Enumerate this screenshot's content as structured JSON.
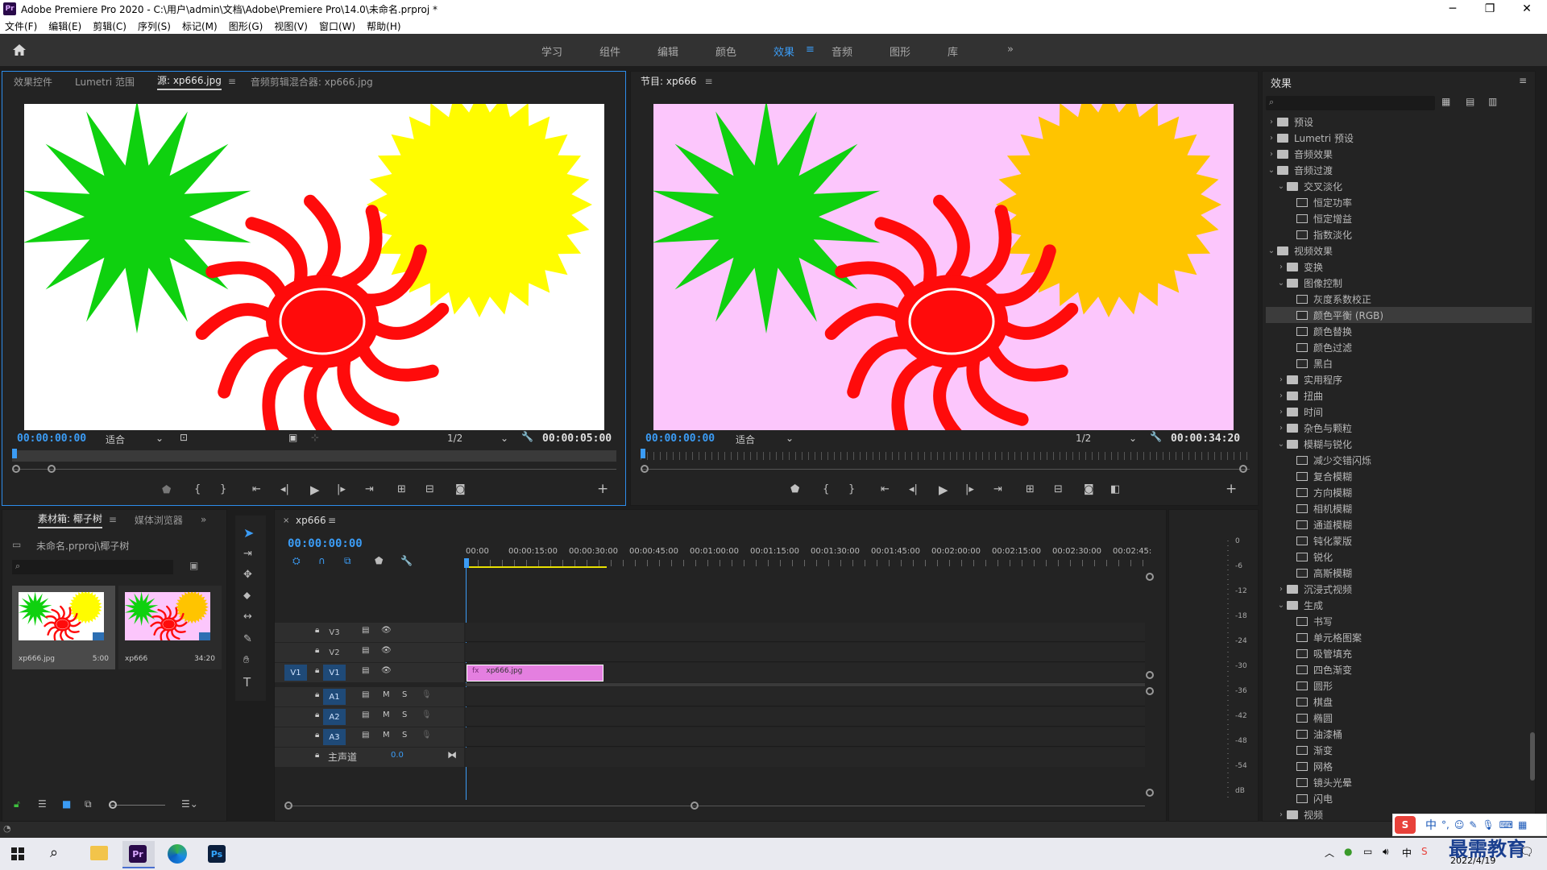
{
  "window": {
    "app_icon": "Pr",
    "title": "Adobe Premiere Pro 2020 - C:\\用户\\admin\\文档\\Adobe\\Premiere Pro\\14.0\\未命名.prproj *"
  },
  "menu": [
    "文件(F)",
    "编辑(E)",
    "剪辑(C)",
    "序列(S)",
    "标记(M)",
    "图形(G)",
    "视图(V)",
    "窗口(W)",
    "帮助(H)"
  ],
  "workspaces": {
    "tabs": [
      "学习",
      "组件",
      "编辑",
      "颜色",
      "效果",
      "音频",
      "图形",
      "库"
    ],
    "active": "效果"
  },
  "source_panel": {
    "tabs": [
      "效果控件",
      "Lumetri 范围",
      "源: xp666.jpg",
      "音频剪辑混合器: xp666.jpg"
    ],
    "timecode": "00:00:00:00",
    "fit": "适合",
    "resolution": "1/2",
    "duration": "00:00:05:00",
    "background": "#ffffff"
  },
  "program_panel": {
    "tab": "节目: xp666",
    "timecode": "00:00:00:00",
    "fit": "适合",
    "resolution": "1/2",
    "duration": "00:00:34:20",
    "background": "#fcc6fc"
  },
  "project_panel": {
    "tabs": [
      "素材箱: 椰子树",
      "媒体浏览器"
    ],
    "path": "未命名.prproj\\椰子树",
    "items": [
      {
        "name": "xp666.jpg",
        "duration": "5:00"
      },
      {
        "name": "xp666",
        "duration": "34:20"
      }
    ]
  },
  "timeline": {
    "tab": "xp666",
    "timecode": "00:00:00:00",
    "ruler": [
      "00:00",
      "00:00:15:00",
      "00:00:30:00",
      "00:00:45:00",
      "00:01:00:00",
      "00:01:15:00",
      "00:01:30:00",
      "00:01:45:00",
      "00:02:00:00",
      "00:02:15:00",
      "00:02:30:00",
      "00:02:45:"
    ],
    "video_tracks": [
      "V3",
      "V2",
      "V1"
    ],
    "audio_tracks": [
      "A1",
      "A2",
      "A3"
    ],
    "source_patch": "V1",
    "master": {
      "label": "主声道",
      "value": "0.0"
    },
    "clip": {
      "name": "xp666.jpg",
      "color": "#e47fe0"
    },
    "meter_labels": [
      "0",
      "-6",
      "-12",
      "-18",
      "-24",
      "-30",
      "-36",
      "-42",
      "-48",
      "-54",
      "dB"
    ]
  },
  "effects_panel": {
    "title": "效果",
    "search_placeholder": "",
    "tree": [
      {
        "label": "预设",
        "level": 0,
        "type": "folder",
        "open": false
      },
      {
        "label": "Lumetri 预设",
        "level": 0,
        "type": "folder",
        "open": false
      },
      {
        "label": "音频效果",
        "level": 0,
        "type": "folder",
        "open": false
      },
      {
        "label": "音频过渡",
        "level": 0,
        "type": "folder",
        "open": true
      },
      {
        "label": "交叉淡化",
        "level": 1,
        "type": "folder",
        "open": true
      },
      {
        "label": "恒定功率",
        "level": 2,
        "type": "fx"
      },
      {
        "label": "恒定增益",
        "level": 2,
        "type": "fx"
      },
      {
        "label": "指数淡化",
        "level": 2,
        "type": "fx"
      },
      {
        "label": "视频效果",
        "level": 0,
        "type": "folder",
        "open": true
      },
      {
        "label": "变换",
        "level": 1,
        "type": "folder",
        "open": false
      },
      {
        "label": "图像控制",
        "level": 1,
        "type": "folder",
        "open": true
      },
      {
        "label": "灰度系数校正",
        "level": 2,
        "type": "fx"
      },
      {
        "label": "颜色平衡 (RGB)",
        "level": 2,
        "type": "fx",
        "selected": true
      },
      {
        "label": "颜色替换",
        "level": 2,
        "type": "fx"
      },
      {
        "label": "颜色过滤",
        "level": 2,
        "type": "fx"
      },
      {
        "label": "黑白",
        "level": 2,
        "type": "fx"
      },
      {
        "label": "实用程序",
        "level": 1,
        "type": "folder",
        "open": false
      },
      {
        "label": "扭曲",
        "level": 1,
        "type": "folder",
        "open": false
      },
      {
        "label": "时间",
        "level": 1,
        "type": "folder",
        "open": false
      },
      {
        "label": "杂色与颗粒",
        "level": 1,
        "type": "folder",
        "open": false
      },
      {
        "label": "模糊与锐化",
        "level": 1,
        "type": "folder",
        "open": true
      },
      {
        "label": "减少交错闪烁",
        "level": 2,
        "type": "fx"
      },
      {
        "label": "复合模糊",
        "level": 2,
        "type": "fx"
      },
      {
        "label": "方向模糊",
        "level": 2,
        "type": "fx"
      },
      {
        "label": "相机模糊",
        "level": 2,
        "type": "fx"
      },
      {
        "label": "通道模糊",
        "level": 2,
        "type": "fx"
      },
      {
        "label": "钝化蒙版",
        "level": 2,
        "type": "fx"
      },
      {
        "label": "锐化",
        "level": 2,
        "type": "fx"
      },
      {
        "label": "高斯模糊",
        "level": 2,
        "type": "fx"
      },
      {
        "label": "沉浸式视频",
        "level": 1,
        "type": "folder",
        "open": false
      },
      {
        "label": "生成",
        "level": 1,
        "type": "folder",
        "open": true
      },
      {
        "label": "书写",
        "level": 2,
        "type": "fx"
      },
      {
        "label": "单元格图案",
        "level": 2,
        "type": "fx"
      },
      {
        "label": "吸管填充",
        "level": 2,
        "type": "fx"
      },
      {
        "label": "四色渐变",
        "level": 2,
        "type": "fx"
      },
      {
        "label": "圆形",
        "level": 2,
        "type": "fx"
      },
      {
        "label": "棋盘",
        "level": 2,
        "type": "fx"
      },
      {
        "label": "椭圆",
        "level": 2,
        "type": "fx"
      },
      {
        "label": "油漆桶",
        "level": 2,
        "type": "fx"
      },
      {
        "label": "渐变",
        "level": 2,
        "type": "fx"
      },
      {
        "label": "网格",
        "level": 2,
        "type": "fx"
      },
      {
        "label": "镜头光晕",
        "level": 2,
        "type": "fx"
      },
      {
        "label": "闪电",
        "level": 2,
        "type": "fx"
      },
      {
        "label": "视频",
        "level": 1,
        "type": "folder",
        "open": false
      }
    ]
  },
  "taskbar": {
    "date": "2022/4/19",
    "ime": "中",
    "watermark": "最需教育"
  },
  "colors": {
    "accent": "#3b9cf5",
    "green_star": "#0fd10f",
    "yellow_source": "#fffc00",
    "yellow_program": "#ffc400",
    "red_sun": "#ff0b0b"
  }
}
